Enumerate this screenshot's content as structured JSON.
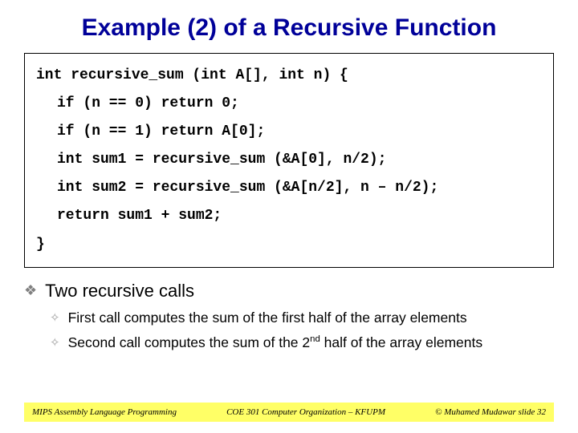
{
  "title": "Example (2) of a Recursive Function",
  "code": {
    "sig": "int recursive_sum (int A[], int n) {",
    "l1": "if (n == 0) return 0;",
    "l2": "if (n == 1) return A[0];",
    "l3": "int sum1 = recursive_sum (&A[0], n/2);",
    "l4": "int sum2 = recursive_sum (&A[n/2], n – n/2);",
    "l5": "return sum1 + sum2;",
    "close": "}"
  },
  "bullets": {
    "main": "Two recursive calls",
    "sub1": "First call computes the sum of the first half of the array elements",
    "sub2_a": "Second call computes the sum of the 2",
    "sub2_sup": "nd",
    "sub2_b": " half of the array elements"
  },
  "footer": {
    "left": "MIPS Assembly Language Programming",
    "mid": "COE 301 Computer Organization – KFUPM",
    "right": "© Muhamed Mudawar   slide 32"
  },
  "glyphs": {
    "diamond_solid": "❖",
    "diamond_open": "✧"
  }
}
